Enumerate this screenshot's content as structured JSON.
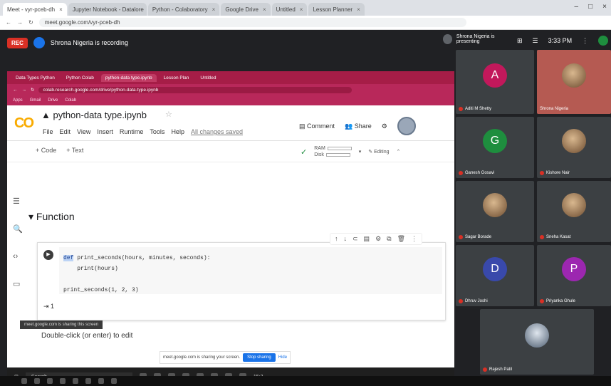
{
  "outer_browser": {
    "tabs": [
      "Meet - vyr-pceb-dh",
      "Jupyter Notebook - Datalore",
      "Python - Colaboratory",
      "Google Drive",
      "Untitled",
      "Lesson Planner"
    ],
    "url": "meet.google.com/vyr-pceb-dh"
  },
  "meet": {
    "rec_badge": "REC",
    "recording_text": "Shrona Nigeria is recording",
    "presenter_name": "Shrona Nigeria is presenting",
    "time": "3:33 PM"
  },
  "inner_browser": {
    "tabs": [
      "Data Types Python",
      "Python Colab",
      "python-data type.ipynb",
      "Lesson Plan",
      "Untitled"
    ],
    "url": "colab.research.google.com/drive/python-data-type.ipynb",
    "bookmarks": [
      "Apps",
      "Gmail",
      "Drive",
      "Colab"
    ]
  },
  "colab": {
    "logo_co": "CO",
    "notebook_title": "python-data type.ipynb",
    "menu": [
      "File",
      "Edit",
      "View",
      "Insert",
      "Runtime",
      "Tools",
      "Help"
    ],
    "saved_text": "All changes saved",
    "comment_label": "Comment",
    "share_label": "Share",
    "add_code": "+ Code",
    "add_text": "+ Text",
    "ram_label": "RAM",
    "disk_label": "Disk",
    "editing_label": "Editing",
    "section_title": "Function",
    "code_line1_kw": "def",
    "code_line1_rest": " print_seconds(hours, minutes, seconds):",
    "code_line2": "    print(hours)",
    "code_line3": "print_seconds(1, 2, 3)",
    "output": "1",
    "text_cell": "Double-click (or enter) to edit"
  },
  "share_bar": {
    "message": "meet.google.com is sharing your screen.",
    "stop_label": "Stop sharing",
    "hide_label": "Hide"
  },
  "inner_taskbar": {
    "search_placeholder": "Search",
    "time": "15:3"
  },
  "status_message": "meet.google.com is sharing this screen",
  "participants": [
    {
      "letter": "A",
      "name": "Aditi M Shetty",
      "color": "#c2185b"
    },
    {
      "letter": "",
      "name": "Shrona Nigeria",
      "color": ""
    },
    {
      "letter": "G",
      "name": "Ganesh Gosavi",
      "color": "#1e8e3e"
    },
    {
      "letter": "",
      "name": "Kishore Nair",
      "color": ""
    },
    {
      "letter": "",
      "name": "Sagar Borade",
      "color": ""
    },
    {
      "letter": "",
      "name": "Sneha Kasat",
      "color": ""
    },
    {
      "letter": "D",
      "name": "Dhruv Joshi",
      "color": "#3949ab"
    },
    {
      "letter": "P",
      "name": "Priyanka Ghule",
      "color": "#9c27b0"
    },
    {
      "letter": "",
      "name": "Rajesh Patil",
      "color": ""
    }
  ]
}
